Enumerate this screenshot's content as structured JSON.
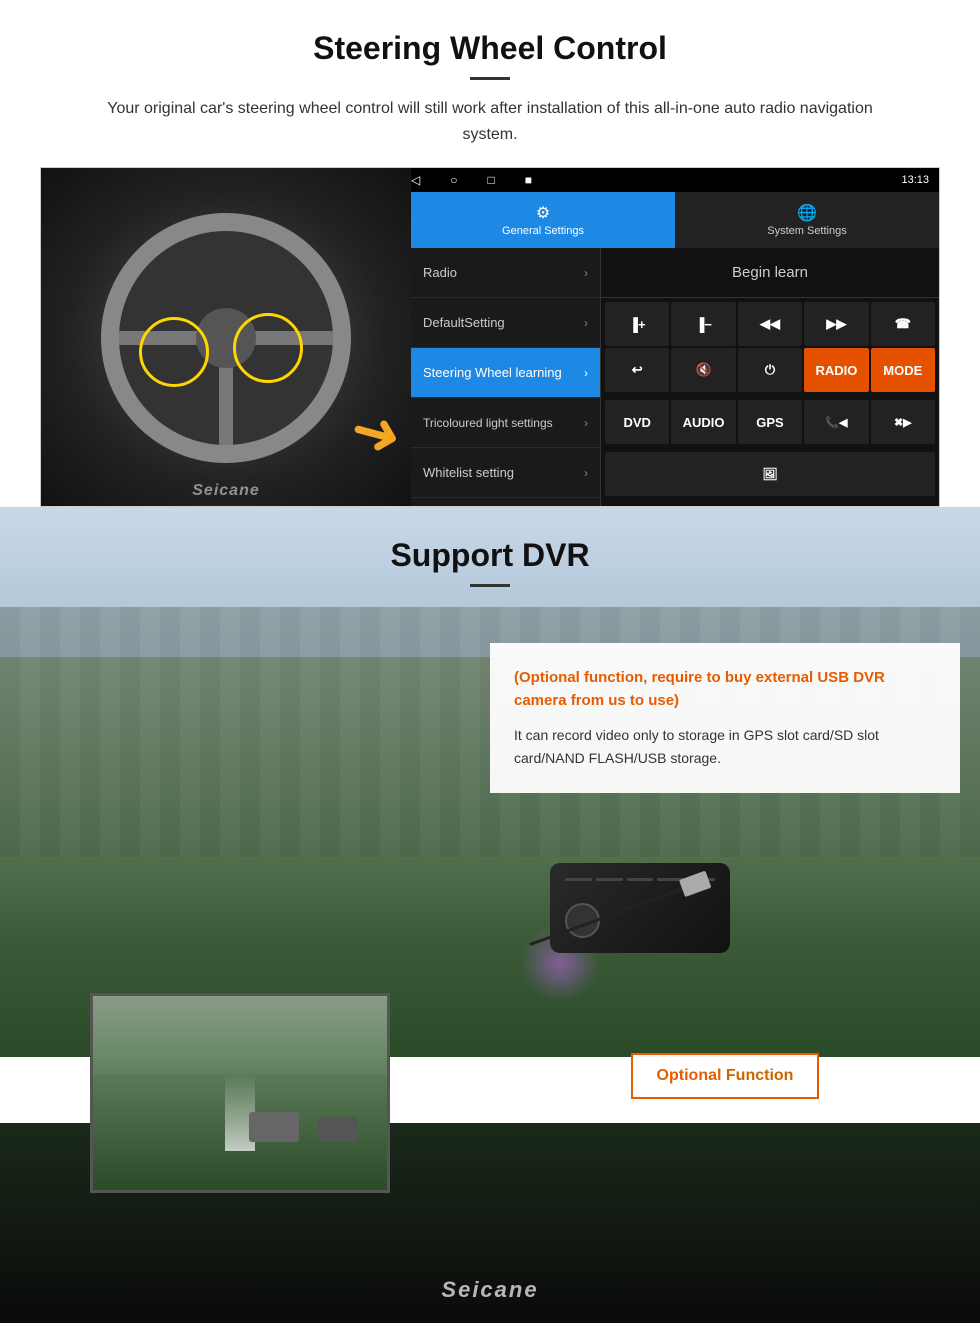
{
  "page": {
    "bg_color": "#ffffff"
  },
  "steering": {
    "title": "Steering Wheel Control",
    "description": "Your original car's steering wheel control will still work after installation of this all-in-one auto radio navigation system.",
    "statusbar": {
      "time": "13:13",
      "signal_icon": "▾",
      "wifi_icon": "▾"
    },
    "tabs": {
      "general": {
        "label": "General Settings",
        "icon": "⚙"
      },
      "system": {
        "label": "System Settings",
        "icon": "🌐"
      }
    },
    "menu_items": [
      {
        "label": "Radio",
        "active": false
      },
      {
        "label": "DefaultSetting",
        "active": false
      },
      {
        "label": "Steering Wheel learning",
        "active": true
      },
      {
        "label": "Tricoloured light settings",
        "active": false
      },
      {
        "label": "Whitelist setting",
        "active": false
      }
    ],
    "begin_learn_label": "Begin learn",
    "control_buttons": [
      {
        "label": "▐+",
        "row": 1
      },
      {
        "label": "▐−",
        "row": 1
      },
      {
        "label": "◀◀",
        "row": 1
      },
      {
        "label": "▶▶",
        "row": 1
      },
      {
        "label": "☎",
        "row": 1
      },
      {
        "label": "↩",
        "row": 2
      },
      {
        "label": "🔇",
        "row": 2
      },
      {
        "label": "⏻",
        "row": 2
      },
      {
        "label": "RADIO",
        "row": 2
      },
      {
        "label": "MODE",
        "row": 2
      },
      {
        "label": "DVD",
        "row": 3
      },
      {
        "label": "AUDIO",
        "row": 3
      },
      {
        "label": "GPS",
        "row": 3
      },
      {
        "label": "📞◀◀",
        "row": 3
      },
      {
        "label": "✖▶▶",
        "row": 3
      }
    ],
    "nav_buttons": [
      "◁",
      "○",
      "□",
      "■"
    ]
  },
  "dvr": {
    "title": "Support DVR",
    "optional_text": "(Optional function, require to buy external USB DVR camera from us to use)",
    "desc_text": "It can record video only to storage in GPS slot card/SD slot card/NAND FLASH/USB storage.",
    "optional_function_label": "Optional",
    "function_label": "Function",
    "seicane_label": "Seicane"
  }
}
